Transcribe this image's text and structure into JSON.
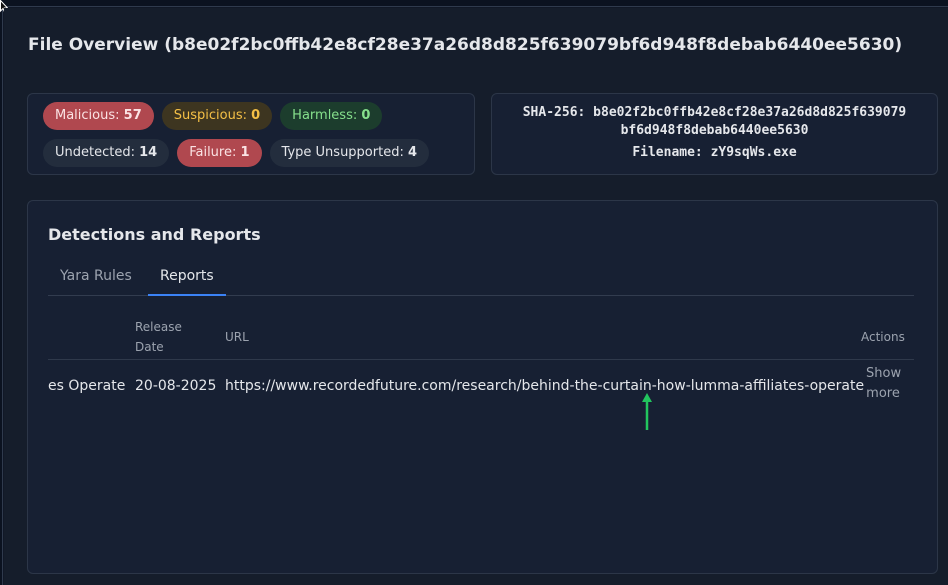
{
  "page": {
    "title": "File Overview (b8e02f2bc0ffb42e8cf28e37a26d8d825f639079bf6d948f8debab6440ee5630)"
  },
  "stats": [
    {
      "label": "Malicious: ",
      "value": "57"
    },
    {
      "label": "Suspicious: ",
      "value": "0"
    },
    {
      "label": "Harmless: ",
      "value": "0"
    },
    {
      "label": "Undetected: ",
      "value": "14"
    },
    {
      "label": "Failure: ",
      "value": "1"
    },
    {
      "label": "Type Unsupported: ",
      "value": "4"
    }
  ],
  "file": {
    "sha_line1": "SHA-256: b8e02f2bc0ffb42e8cf28e37a26d8d825f639079",
    "sha_line2": "bf6d948f8debab6440ee5630",
    "filename": "Filename: zY9sqWs.exe"
  },
  "detections": {
    "title": "Detections and Reports",
    "tabs": [
      "Yara Rules",
      "Reports"
    ],
    "active_tab": "Reports",
    "columns": {
      "date": "Release Date",
      "url": "URL",
      "actions": "Actions"
    },
    "rows": [
      {
        "name": "es Operate",
        "date": "20-08-2025",
        "url": "https://www.recordedfuture.com/research/behind-the-curtain-how-lumma-affiliates-operate",
        "action": "Show more"
      }
    ]
  },
  "colors": {
    "accent": "#3b82f6",
    "malicious": "#b0484f",
    "suspicious": "#f5c046",
    "harmless": "#86e08c",
    "arrow": "#22c55e"
  }
}
